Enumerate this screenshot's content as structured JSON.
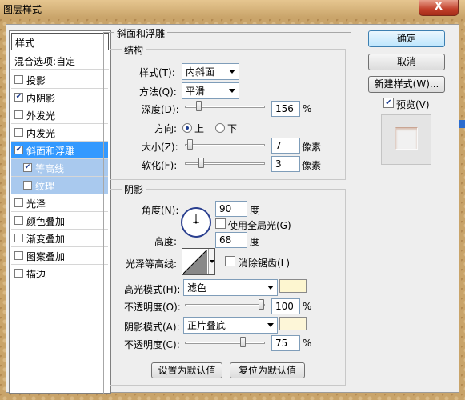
{
  "window": {
    "title": "图层样式",
    "close": "X"
  },
  "styles_panel": {
    "header": "样式",
    "blend": "混合选项:自定",
    "items": [
      {
        "label": "投影",
        "checked": false
      },
      {
        "label": "内阴影",
        "checked": true
      },
      {
        "label": "外发光",
        "checked": false
      },
      {
        "label": "内发光",
        "checked": false
      },
      {
        "label": "斜面和浮雕",
        "checked": true
      },
      {
        "label": "等高线",
        "checked": true
      },
      {
        "label": "纹理",
        "checked": false
      },
      {
        "label": "光泽",
        "checked": false
      },
      {
        "label": "颜色叠加",
        "checked": false
      },
      {
        "label": "渐变叠加",
        "checked": false
      },
      {
        "label": "图案叠加",
        "checked": false
      },
      {
        "label": "描边",
        "checked": false
      }
    ]
  },
  "bevel": {
    "section_title": "斜面和浮雕",
    "structure": {
      "title": "结构",
      "style_label": "样式(T):",
      "style_value": "内斜面",
      "technique_label": "方法(Q):",
      "technique_value": "平滑",
      "depth_label": "深度(D):",
      "depth_value": "156",
      "depth_unit": "%",
      "depth_slider": 0.156,
      "direction_label": "方向:",
      "dir_up": "上",
      "dir_down": "下",
      "direction_selected": "上",
      "size_label": "大小(Z):",
      "size_value": "7",
      "size_unit": "像素",
      "size_slider": 0.03,
      "soften_label": "软化(F):",
      "soften_value": "3",
      "soften_unit": "像素",
      "soften_slider": 0.18
    },
    "shading": {
      "title": "阴影",
      "angle_label": "角度(N):",
      "angle_value": "90",
      "angle_unit": "度",
      "global_light_label": "使用全局光(G)",
      "global_light_checked": false,
      "altitude_label": "高度:",
      "altitude_value": "68",
      "altitude_unit": "度",
      "gloss_label": "光泽等高线:",
      "antialias_label": "消除锯齿(L)",
      "antialias_checked": false,
      "highlight_mode_label": "高光模式(H):",
      "highlight_mode_value": "滤色",
      "highlight_color": "#fdf6d0",
      "highlight_opacity_label": "不透明度(O):",
      "highlight_opacity_value": "100",
      "highlight_opacity_unit": "%",
      "highlight_opacity_slider": 1.0,
      "shadow_mode_label": "阴影模式(A):",
      "shadow_mode_value": "正片叠底",
      "shadow_color": "#fdf6d8",
      "shadow_opacity_label": "不透明度(C):",
      "shadow_opacity_value": "75",
      "shadow_opacity_unit": "%",
      "shadow_opacity_slider": 0.75
    },
    "make_default": "设置为默认值",
    "reset_default": "复位为默认值"
  },
  "buttons": {
    "ok": "确定",
    "cancel": "取消",
    "new_style": "新建样式(W)...",
    "preview": "预览(V)",
    "preview_checked": true
  },
  "colors": {
    "selection": "#3399ff",
    "selection_sub": "#a9c9ee",
    "window_bg": "#eeeeee"
  }
}
